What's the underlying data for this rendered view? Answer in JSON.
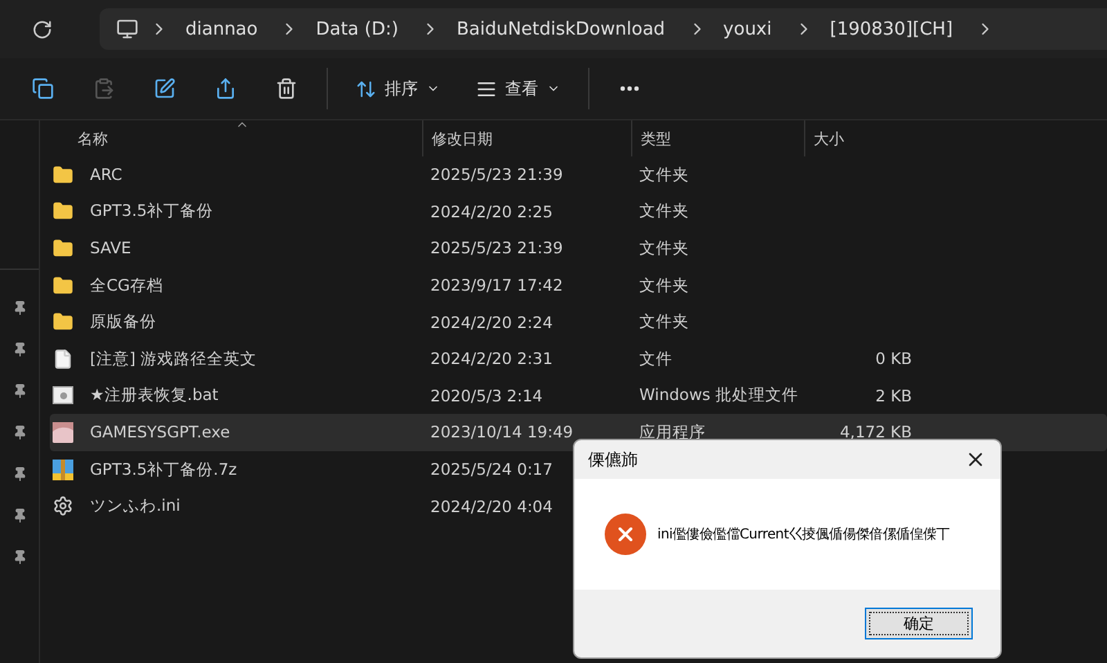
{
  "address_bar": {
    "crumbs": [
      "diannao",
      "Data (D:)",
      "BaiduNetdiskDownload",
      "youxi",
      "[190830][CH]"
    ]
  },
  "toolbar": {
    "buttons": [
      {
        "kind": "copy",
        "disabled": false
      },
      {
        "kind": "paste",
        "disabled": true
      },
      {
        "kind": "rename",
        "disabled": false
      },
      {
        "kind": "share",
        "disabled": false
      },
      {
        "kind": "delete",
        "disabled": false
      }
    ],
    "sort": "排序",
    "view": "查看"
  },
  "sidebar": {
    "items": [
      {
        "pinned": true
      },
      {
        "pinned": true
      },
      {
        "pinned": true
      },
      {
        "pinned": true
      },
      {
        "pinned": true
      },
      {
        "pinned": true
      },
      {
        "pinned": true
      }
    ]
  },
  "table": {
    "columns": [
      "名称",
      "修改日期",
      "类型",
      "大小"
    ],
    "rows": [
      {
        "kind": "folder",
        "name": "ARC",
        "date": "2025/5/23 21:39",
        "type": "文件夹",
        "size": "",
        "selected": false
      },
      {
        "kind": "folder",
        "name": "GPT3.5补丁备份",
        "date": "2024/2/20 2:25",
        "type": "文件夹",
        "size": "",
        "selected": false
      },
      {
        "kind": "folder",
        "name": "SAVE",
        "date": "2025/5/23 21:39",
        "type": "文件夹",
        "size": "",
        "selected": false
      },
      {
        "kind": "folder",
        "name": "全CG存档",
        "date": "2023/9/17 17:42",
        "type": "文件夹",
        "size": "",
        "selected": false
      },
      {
        "kind": "folder",
        "name": "原版备份",
        "date": "2024/2/20 2:24",
        "type": "文件夹",
        "size": "",
        "selected": false
      },
      {
        "kind": "file",
        "name": "[注意] 游戏路径全英文",
        "date": "2024/2/20 2:31",
        "type": "文件",
        "size": "0 KB",
        "selected": false
      },
      {
        "kind": "batch",
        "name": "★注册表恢复.bat",
        "date": "2020/5/3 2:14",
        "type": "Windows 批处理文件",
        "size": "2 KB",
        "selected": false
      },
      {
        "kind": "app",
        "name": "GAMESYSGPT.exe",
        "date": "2023/10/14 19:49",
        "type": "应用程序",
        "size": "4,172 KB",
        "selected": true
      },
      {
        "kind": "archive",
        "name": "GPT3.5补丁备份.7z",
        "date": "2025/5/24 0:17",
        "selected": false
      },
      {
        "kind": "settings",
        "name": "ツンふわ.ini",
        "date": "2024/2/20 4:04",
        "selected": false
      }
    ]
  },
  "dialog": {
    "title": "傈儦斾",
    "message": "ini儖僂儉儖儅Current巜掕偑偱偒傑偣傫偱偟偨丅",
    "button": "确定"
  }
}
